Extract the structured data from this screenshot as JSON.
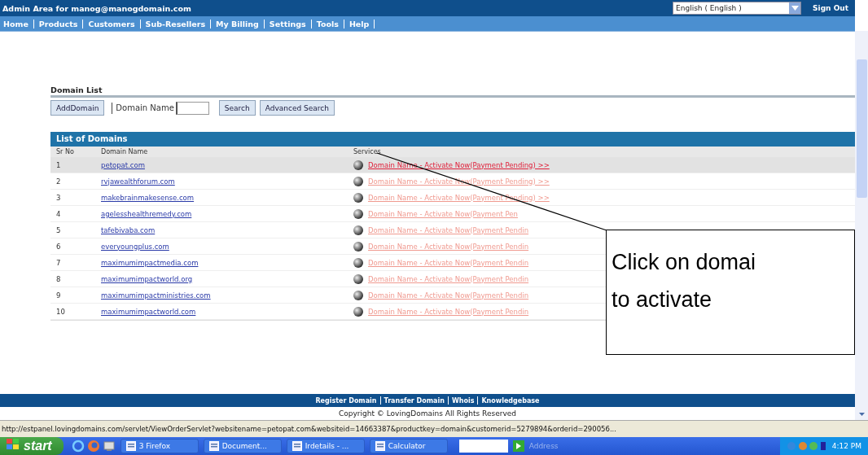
{
  "header": {
    "title": "Admin Area for manog@manogdomain.com",
    "language": "English ( English )",
    "sign_out": "Sign Out"
  },
  "nav": [
    "Home",
    "Products",
    "Customers",
    "Sub-Resellers",
    "My Billing",
    "Settings",
    "Tools",
    "Help"
  ],
  "domain_list": {
    "title": "Domain List",
    "add_button": "AddDomain",
    "field_label": "Domain Name",
    "search_button": "Search",
    "advanced_button": "Advanced Search"
  },
  "table": {
    "title": "List of Domains",
    "columns": [
      "Sr No",
      "Domain Name",
      "Services"
    ],
    "rows": [
      {
        "no": "1",
        "domain": "petopat.com",
        "service": "Domain Name - Activate Now(Payment Pending) >>",
        "selected": true
      },
      {
        "no": "2",
        "domain": "rvjawealthforum.com",
        "service": "Domain Name - Activate Now(Payment Pending) >>",
        "selected": false
      },
      {
        "no": "3",
        "domain": "makebrainmakesense.com",
        "service": "Domain Name - Activate Now(Payment Pending) >>",
        "selected": false
      },
      {
        "no": "4",
        "domain": "agelesshealthremedy.com",
        "service": "Domain Name - Activate Now(Payment Pen",
        "selected": false
      },
      {
        "no": "5",
        "domain": "tafebivaba.com",
        "service": "Domain Name - Activate Now(Payment Pendin",
        "selected": false
      },
      {
        "no": "6",
        "domain": "everyoungplus.com",
        "service": "Domain Name - Activate Now(Payment Pendin",
        "selected": false
      },
      {
        "no": "7",
        "domain": "maximumimpactmedia.com",
        "service": "Domain Name - Activate Now(Payment Pendin",
        "selected": false
      },
      {
        "no": "8",
        "domain": "maximumimpactworld.org",
        "service": "Domain Name - Activate Now(Payment Pendin",
        "selected": false
      },
      {
        "no": "9",
        "domain": "maximumimpactministries.com",
        "service": "Domain Name - Activate Now(Payment Pendin",
        "selected": false
      },
      {
        "no": "10",
        "domain": "maximumimpactworld.com",
        "service": "Domain Name - Activate Now(Payment Pendin",
        "selected": false
      }
    ]
  },
  "callout": {
    "lines": [
      "Click on domai",
      "to activate"
    ]
  },
  "footer": {
    "links": [
      "Register Domain",
      "Transfer Domain",
      "Whois",
      "Knowledgebase"
    ],
    "copyright": "Copyright © LovingDomains All Rights Reserved"
  },
  "status_bar": "http://estpanel.lovingdomains.com/servlet/ViewOrderServlet?websitename=petopat.com&websiteid=14663387&productkey=domain&customerid=5279894&orderid=290056...",
  "taskbar": {
    "start": "start",
    "items": [
      "3 Firefox",
      "Document...",
      "Irdetails - ...",
      "Calculator"
    ],
    "address": "Address",
    "clock": "4:12 PM"
  }
}
